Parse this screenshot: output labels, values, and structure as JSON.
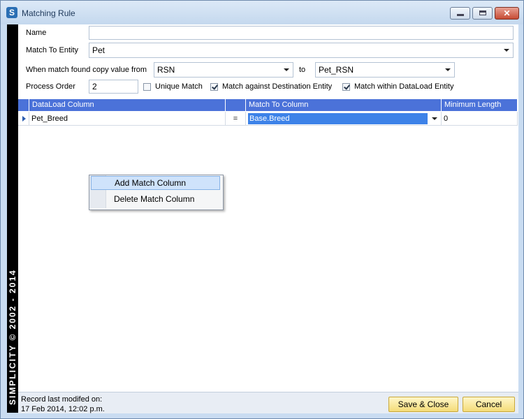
{
  "window": {
    "title": "Matching Rule",
    "close_glyph": "✕",
    "app_icon_letter": "S"
  },
  "sidebar": {
    "text": "SIMPLICITY © 2002 - 2014"
  },
  "form": {
    "name_label": "Name",
    "name_value": "",
    "entity_label": "Match To Entity",
    "entity_value": "Pet",
    "copy_label": "When match found copy value from",
    "copy_from": "RSN",
    "to_label": "to",
    "copy_to": "Pet_RSN",
    "order_label": "Process Order",
    "order_value": "2",
    "unique_label": "Unique Match",
    "unique_checked": false,
    "destination_label": "Match against Destination Entity",
    "destination_checked": true,
    "within_label": "Match within DataLoad Entity",
    "within_checked": true
  },
  "grid": {
    "columns": [
      "DataLoad Column",
      "",
      "Match To Column",
      "Minimum Length"
    ],
    "rows": [
      {
        "dataload": "Pet_Breed",
        "op": "=",
        "match": "Base.Breed",
        "min_length": "0"
      }
    ]
  },
  "context_menu": {
    "items": [
      "Add Match Column",
      "Delete Match Column"
    ]
  },
  "footer": {
    "record_label": "Record last modifed on:",
    "record_date": "17 Feb 2014, 12:02 p.m.",
    "save_label": "Save & Close",
    "cancel_label": "Cancel"
  }
}
